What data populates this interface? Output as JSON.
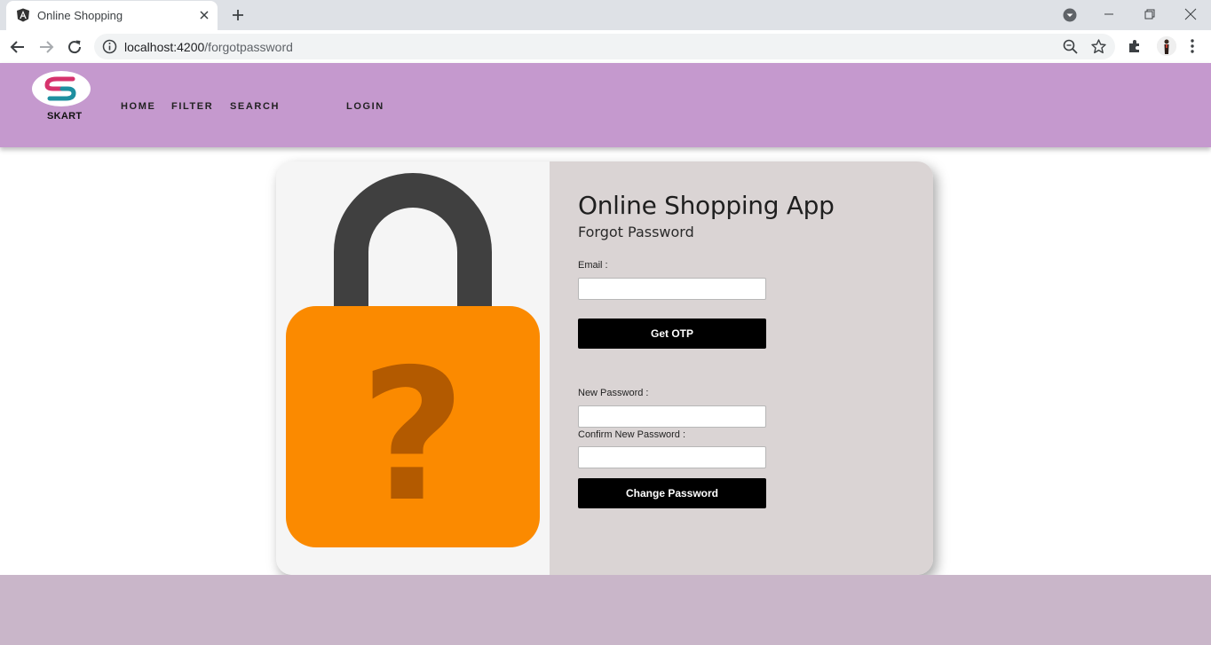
{
  "browser": {
    "tab_title": "Online Shopping",
    "url_host": "localhost:4200",
    "url_path": "/forgotpassword"
  },
  "header": {
    "brand": "SKART",
    "nav": {
      "home": "HOME",
      "filter": "FILTER",
      "search": "SEARCH",
      "login": "LOGIN"
    }
  },
  "form": {
    "title": "Online Shopping App",
    "subtitle": "Forgot Password",
    "email_label": "Email :",
    "email_value": "",
    "otp_button": "Get OTP",
    "new_password_label": "New Password :",
    "new_password_value": "",
    "confirm_password_label": "Confirm New Password :",
    "confirm_password_value": "",
    "change_button": "Change Password"
  },
  "illustration": {
    "symbol": "?",
    "lock_body_color": "#fb8a00",
    "shackle_color": "#404040",
    "question_color": "#b35a00"
  },
  "colors": {
    "header_bg": "#c599ce",
    "footer_bg": "#c9b6c9",
    "card_right_bg": "#dad4d4",
    "button_bg": "#000000"
  }
}
